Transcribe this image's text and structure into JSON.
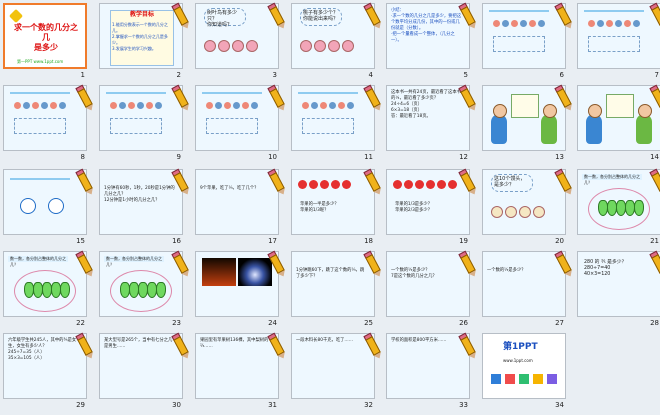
{
  "slides": [
    {
      "n": "1",
      "title": "求一个数的几分之几\n是多少",
      "footer": "第一PPT www.1ppt.com"
    },
    {
      "n": "2",
      "heading": "教学目标",
      "text": "1.能用分数表示一个数的几分之几。\n2.掌握求一个数的几分之几是多少。\n3.发展学生的学习兴趣。"
    },
    {
      "n": "3",
      "bubble": "树叶鸟有多少只？\n你知道吗？"
    },
    {
      "n": "4",
      "bubble": "桃子有多少个？\n你能说出来吗？"
    },
    {
      "n": "5",
      "text": "小结：\n·求一个数的几分之几是多少，要把这个数平均分成几份，其中的一份或几份就是（分数）。\n·把一个量看成一个整体，（几分之一）。"
    },
    {
      "n": "6"
    },
    {
      "n": "7"
    },
    {
      "n": "8"
    },
    {
      "n": "9"
    },
    {
      "n": "10"
    },
    {
      "n": "11"
    },
    {
      "n": "12",
      "text": "这本书一共有24页，最近看了这本书的¼，最近看了多少页？\n24÷4=6（页）\n6×3=18（页）\n答：最近看了18页。"
    },
    {
      "n": "13"
    },
    {
      "n": "14"
    },
    {
      "n": "15"
    },
    {
      "n": "16",
      "text": "1分钟有60秒，1秒。20秒是1分钟的几分之几？\n12分钟是1小时的几分之几？"
    },
    {
      "n": "17",
      "text": "9个苹果，吃了⅓，吃了几个？"
    },
    {
      "n": "18",
      "text": "苹果的一半是多少？\n苹果的1/3呢？"
    },
    {
      "n": "19",
      "text": "苹果的1/3是多少？\n苹果的2/3是多少？"
    },
    {
      "n": "20",
      "bubble": "这10个馒头，是多少？"
    },
    {
      "n": "21",
      "text": "数一数，各分别占整体的几分之几？"
    },
    {
      "n": "22",
      "text": "数一数，各分别占整体的几分之几？"
    },
    {
      "n": "23",
      "text": "数一数，各分别占整体的几分之几？"
    },
    {
      "n": "24"
    },
    {
      "n": "25",
      "text": "1分钟跳60下，跳了这个数的⅓，跳了多少下？"
    },
    {
      "n": "26",
      "text": "一个数的⅓是多少？\n7是这个数的几分之几？"
    },
    {
      "n": "27",
      "text": "一个数的⅓是多少？"
    },
    {
      "n": "28",
      "text": "280 的 ⅗ 是多少？\n280÷7=40\n40×3=120"
    },
    {
      "n": "29",
      "text": "六年级学生共245人，其中的⅗是女生，女生有多少人？\n245÷7=35（人）\n35×3=105（人）"
    },
    {
      "n": "30",
      "text": "某大型号是265个，当中有七分之几是男生……"
    },
    {
      "n": "31",
      "text": "果园里有苹果树136棵，其中梨树的⅔……"
    },
    {
      "n": "32",
      "text": "一段木料长80千克，吃了……"
    },
    {
      "n": "33",
      "text": "学校的面积是800平方米……"
    },
    {
      "n": "34",
      "brand": "第1PPT",
      "footer": "www.1ppt.com"
    }
  ],
  "colors": {
    "slide_bg_light": "#eef8ff",
    "slide_bg_white": "#ffffff",
    "accent_blue": "#1b4fbf",
    "accent_red": "#d11a1a",
    "green_bar": "#7bd36b",
    "panel_border": "#b9c7d8"
  }
}
